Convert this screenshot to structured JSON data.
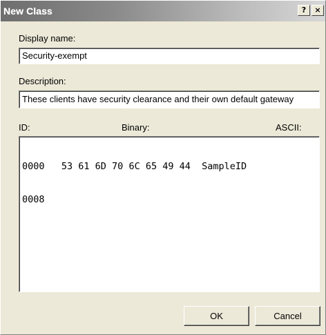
{
  "window": {
    "title": "New Class",
    "help_button": "?",
    "close_button": "×"
  },
  "display_name": {
    "label": "Display name:",
    "value": "Security-exempt"
  },
  "description": {
    "label": "Description:",
    "value": "These clients have security clearance and their own default gateway"
  },
  "data_editor": {
    "columns": {
      "id": "ID:",
      "binary": "Binary:",
      "ascii": "ASCII:"
    },
    "rows": [
      {
        "address": "0000",
        "bytes": "53 61 6D 70 6C 65 49 44",
        "ascii": "SampleID"
      },
      {
        "address": "0008",
        "bytes": "",
        "ascii": ""
      }
    ]
  },
  "buttons": {
    "ok": "OK",
    "cancel": "Cancel"
  }
}
